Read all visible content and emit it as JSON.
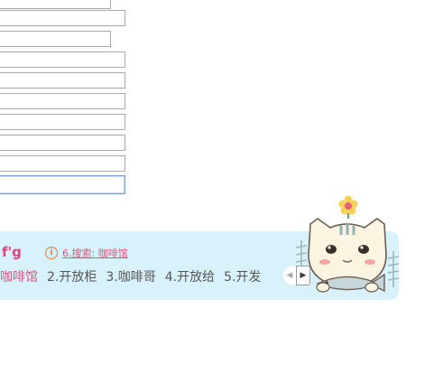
{
  "ime": {
    "composition": "f'g",
    "hint": {
      "icon": "info-circle-icon",
      "text": "6.搜索: 咖啡馆"
    },
    "candidates": [
      {
        "label": "咖啡馆"
      },
      {
        "label": "2.开放柜"
      },
      {
        "label": "3.咖啡哥"
      },
      {
        "label": "4.开放给"
      },
      {
        "label": "5.开发"
      }
    ],
    "pager": {
      "prev_icon": "triangle-left-icon",
      "next_icon": "triangle-right-icon"
    },
    "skin": "cat-holding-fish-illustration"
  },
  "colors": {
    "bar_bg": "#d8f2fb",
    "accent_pink": "#e0437a",
    "hint_orange": "#e37b3a"
  }
}
